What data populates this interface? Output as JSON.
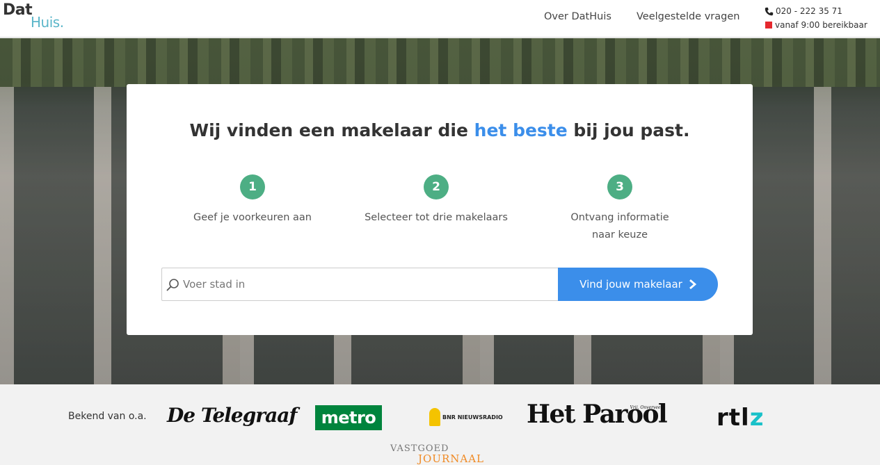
{
  "header": {
    "logo": {
      "part1": "Dat",
      "part2": "Huis."
    },
    "nav": [
      {
        "label": "Over DatHuis"
      },
      {
        "label": "Veelgestelde vragen"
      }
    ],
    "contact": {
      "phone": "020 - 222 35 71",
      "status": "vanaf 9:00 bereikbaar",
      "status_color": "#e5282e"
    }
  },
  "hero": {
    "headline_pre": "Wij vinden een makelaar die ",
    "headline_accent": "het beste",
    "headline_post": " bij jou past.",
    "accent_color": "#3b8eea",
    "steps": [
      {
        "number": "1",
        "label": "Geef je voorkeuren aan"
      },
      {
        "number": "2",
        "label": "Selecteer tot drie makelaars"
      },
      {
        "number": "3",
        "label": "Ontvang informatie naar keuze"
      }
    ],
    "step_color": "#4dae84",
    "search": {
      "placeholder": "Voer stad in",
      "value": "",
      "button_label": "Vind jouw makelaar"
    }
  },
  "press": {
    "label": "Bekend van o.a.",
    "logos": {
      "telegraaf": "De Telegraaf",
      "metro": "metro",
      "bnr": "BNR NIEUWSRADIO",
      "parool": "Het Parool",
      "parool_tag": "Vrij, Onverveerd",
      "rtlz_main": "rtl",
      "rtlz_z": "z",
      "vastgoed_a": "VASTGOED",
      "vastgoed_b": "JOURNAAL"
    }
  }
}
